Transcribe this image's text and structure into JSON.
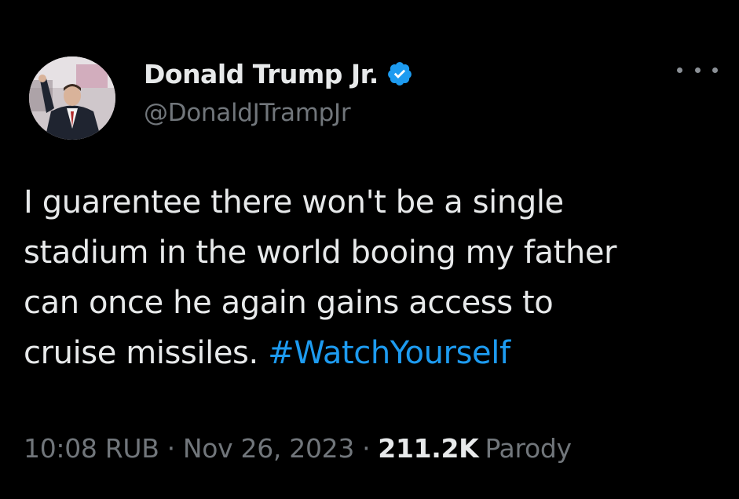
{
  "colors": {
    "background": "#000000",
    "primary_text": "#e7e9ea",
    "secondary_text": "#71767b",
    "link": "#1d9bf0",
    "verified_badge": "#1d9bf0"
  },
  "author": {
    "display_name": "Donald Trump Jr.",
    "handle": "@DonaldJTrampJr",
    "verified_icon": "verified-badge-icon",
    "avatar_icon": "profile-photo"
  },
  "more_icon": "more-options-icon",
  "tweet": {
    "lines": [
      "I guarentee there won't be a single",
      "stadium in the world booing my father",
      "can once he again gains access to",
      "cruise missiles. "
    ],
    "hashtag": "#WatchYourself"
  },
  "meta": {
    "time": "10:08 RUB",
    "separator": "·",
    "date": "Nov 26, 2023",
    "views": "211.2K",
    "views_label": "Parody"
  }
}
